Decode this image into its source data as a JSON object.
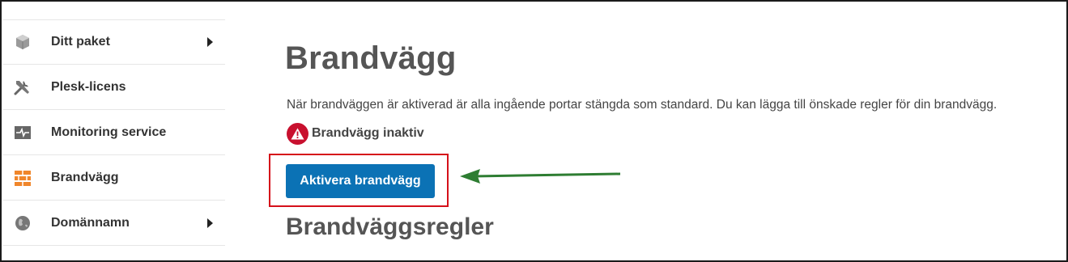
{
  "sidebar": {
    "items": [
      {
        "label": "Ditt paket",
        "icon": "package-icon",
        "has_submenu": true
      },
      {
        "label": "Plesk-licens",
        "icon": "tools-icon",
        "has_submenu": false
      },
      {
        "label": "Monitoring service",
        "icon": "monitor-pulse-icon",
        "has_submenu": false
      },
      {
        "label": "Brandvägg",
        "icon": "firewall-icon",
        "has_submenu": false
      },
      {
        "label": "Domännamn",
        "icon": "globe-icon",
        "has_submenu": true
      }
    ]
  },
  "main": {
    "title": "Brandvägg",
    "description": "När brandväggen är aktiverad är alla ingående portar stängda som standard. Du kan lägga till önskade regler för din brandvägg.",
    "status_text": "Brandvägg inaktiv",
    "activate_button_label": "Aktivera brandvägg",
    "rules_heading": "Brandväggsregler"
  },
  "colors": {
    "primary_button": "#0b72b5",
    "warning": "#c8102e",
    "highlight_border": "#d5101a",
    "arrow": "#2e7d32",
    "active_icon": "#f0862b"
  }
}
